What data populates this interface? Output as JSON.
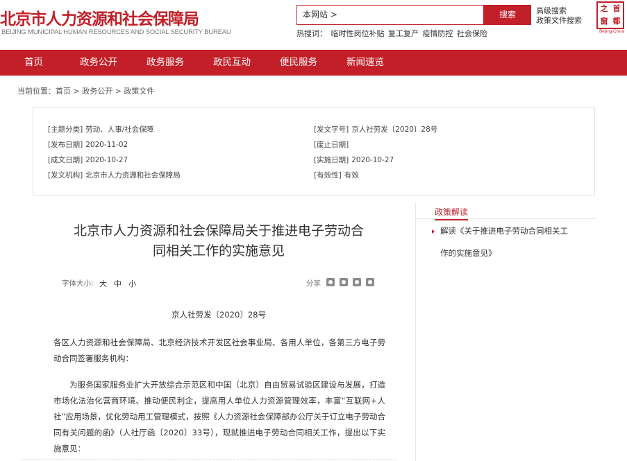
{
  "header": {
    "site_title": "北京市人力资源和社会保障局",
    "site_subtitle": "BEIJING MUNICIPAL HUMAN RESOURCES AND SOCIAL SECURITY BUREAU",
    "search_value": "本网站 >",
    "search_button": "搜索",
    "advanced_search": "高级搜索",
    "policy_search": "政策文件搜索",
    "hotwords_label": "热搜词：",
    "hotwords": [
      "临时性岗位补贴",
      "复工复产",
      "疫情防控",
      "社会保险"
    ],
    "seal_chars": [
      "首",
      "之",
      "都",
      "窗"
    ],
    "seal_caption": "Beijing-China",
    "brand_color": "#c21f28"
  },
  "nav": [
    "首页",
    "政务公开",
    "政务服务",
    "政民互动",
    "便民服务",
    "新闻速览"
  ],
  "breadcrumb": "当前位置：首页 > 政务公开 > 政策文件",
  "meta": {
    "topic_key": "[主题分类]",
    "topic_val": "劳动、人事/社会保障",
    "docno_key": "[发文字号]",
    "docno_val": "京人社劳发〔2020〕28号",
    "pubdate_key": "[发布日期]",
    "pubdate_val": "2020-11-02",
    "abolish_key": "[废止日期]",
    "abolish_val": "",
    "made_key": "[成文日期]",
    "made_val": "2020-10-27",
    "impl_key": "[实施日期]",
    "impl_val": "2020-10-27",
    "issuer_key": "[发文机构]",
    "issuer_val": "北京市人力资源和社会保障局",
    "valid_key": "[有效性]",
    "valid_val": "有效"
  },
  "side": {
    "title": "政策解读",
    "link_line1": "解读《关于推进电子劳动合同相关工",
    "link_line2": "作的实施意见》"
  },
  "doc": {
    "title_line1": "北京市人力资源和社会保障局关于推进电子劳动合",
    "title_line2": "同相关工作的实施意见",
    "font_size_label": "字体大小:",
    "font_large": "大",
    "font_medium": "中",
    "font_small": "小",
    "share_label": "分享",
    "share_icons": [
      "weibo-icon",
      "wechat-icon",
      "print-icon",
      "qr-icon"
    ],
    "number": "京人社劳发〔2020〕28号",
    "para1": "各区人力资源和社会保障局、北京经济技术开发区社会事业局、各用人单位，各第三方电子劳动合同签署服务机构：",
    "para2": "为服务国家服务业扩大开放综合示范区和中国（北京）自由贸易试验区建设与发展，打造市场化法治化营商环境、推动便民利企，提高用人单位人力资源管理效率，丰富“互联网+人社”应用场景，优化劳动用工管理模式，按照《人力资源社会保障部办公厅关于订立电子劳动合同有关问题的函》（人社厅函〔2020〕33号），现就推进电子劳动合同相关工作，提出以下实施意见："
  }
}
